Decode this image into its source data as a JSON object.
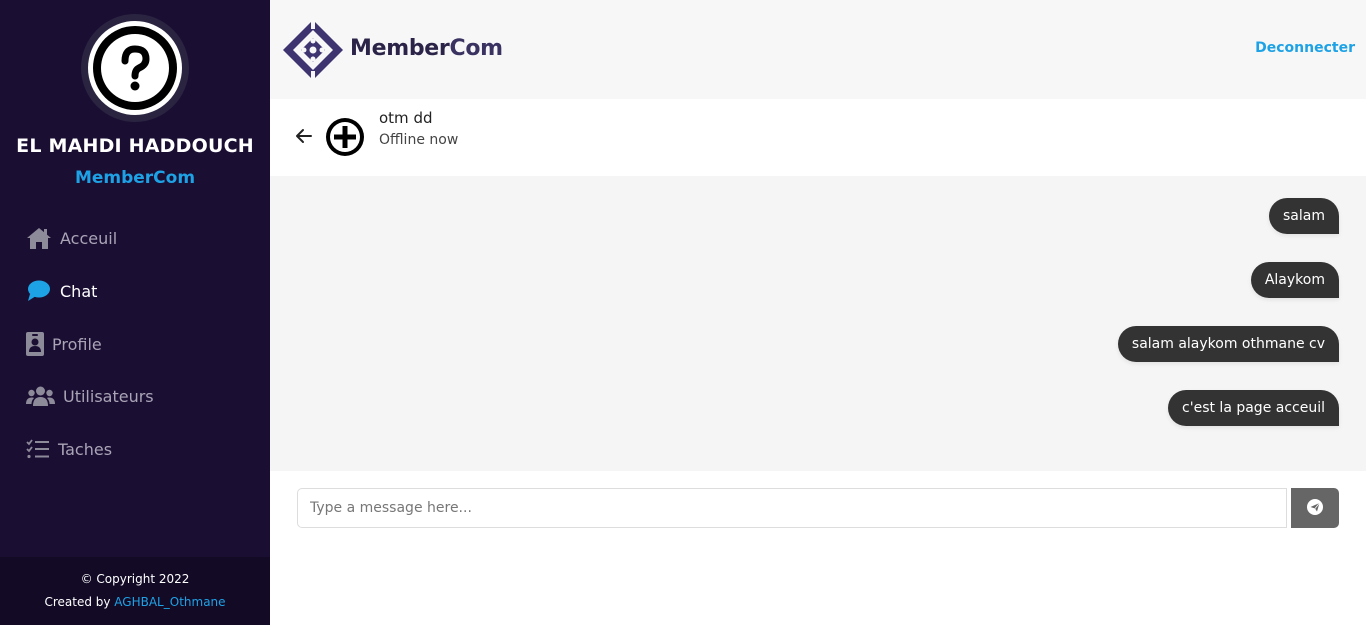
{
  "sidebar": {
    "avatar_icon": "question-mark-icon",
    "user_name": "EL MAHDI HADDOUCH",
    "brand": "MemberCom",
    "nav": [
      {
        "label": "Acceuil",
        "icon": "home-icon",
        "active": false
      },
      {
        "label": "Chat",
        "icon": "chat-bubble-icon",
        "active": true
      },
      {
        "label": "Profile",
        "icon": "id-badge-icon",
        "active": false
      },
      {
        "label": "Utilisateurs",
        "icon": "users-icon",
        "active": false
      },
      {
        "label": "Taches",
        "icon": "task-list-icon",
        "active": false
      }
    ],
    "footer": {
      "copyright": "© Copyright 2022",
      "created_prefix": "Created by ",
      "created_author": "AGHBAL_Othmane"
    }
  },
  "header": {
    "logo_text_main": "Member",
    "logo_text_accent": "Com",
    "logout_label": "Deconnecter"
  },
  "chat": {
    "contact_name": "otm dd",
    "contact_status": "Offline now",
    "messages": [
      {
        "text": "salam",
        "direction": "outgoing"
      },
      {
        "text": "Alaykom",
        "direction": "outgoing"
      },
      {
        "text": "salam alaykom othmane cv",
        "direction": "outgoing"
      },
      {
        "text": "c'est la page acceuil",
        "direction": "outgoing"
      }
    ],
    "input_placeholder": "Type a message here...",
    "input_value": "",
    "send_icon": "paper-plane-icon"
  },
  "colors": {
    "sidebar_bg": "#1b0e33",
    "accent": "#1ea2e6",
    "bubble_bg": "#333333"
  }
}
